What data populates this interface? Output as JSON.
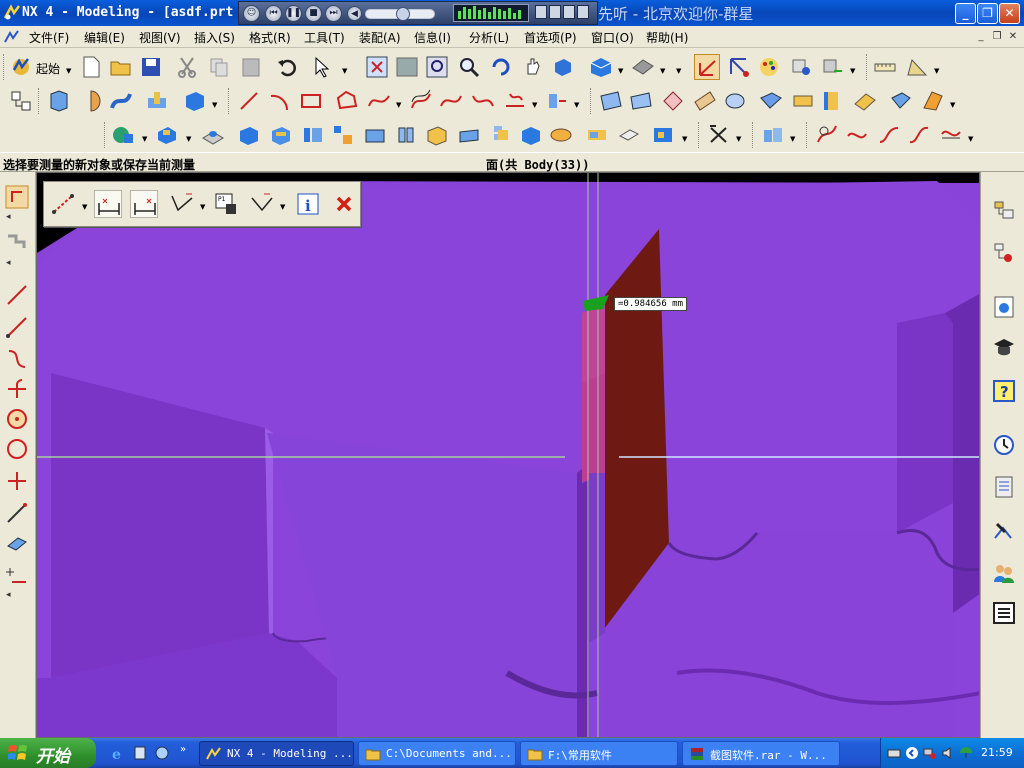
{
  "window": {
    "title": "NX 4 - Modeling - [asdf.prt",
    "ticker_text": "先听 - 北京欢迎你-群星"
  },
  "menu": {
    "items": [
      "文件(F)",
      "编辑(E)",
      "视图(V)",
      "插入(S)",
      "格式(R)",
      "工具(T)",
      "装配(A)",
      "信息(I)",
      "分析(L)",
      "首选项(P)",
      "窗口(O)",
      "帮助(H)"
    ]
  },
  "toolbar": {
    "start_label": "起始"
  },
  "cue": {
    "prompt": "选择要测量的新对象或保存当前测量",
    "status": "面(共 Body(33))"
  },
  "viewport": {
    "measure_value": "=0.984656 mm",
    "colors": {
      "body": "#8a3fd6",
      "body_dark": "#6a2bb0",
      "face_selected": "#6e1a12",
      "highlight": "#c2449a",
      "background": "#000000"
    }
  },
  "taskbar": {
    "start_label": "开始",
    "tasks": [
      {
        "label": "NX 4 - Modeling ..."
      },
      {
        "label": "C:\\Documents and..."
      },
      {
        "label": "F:\\常用软件"
      },
      {
        "label": "截图软件.rar - W..."
      }
    ],
    "clock": "21:59"
  }
}
